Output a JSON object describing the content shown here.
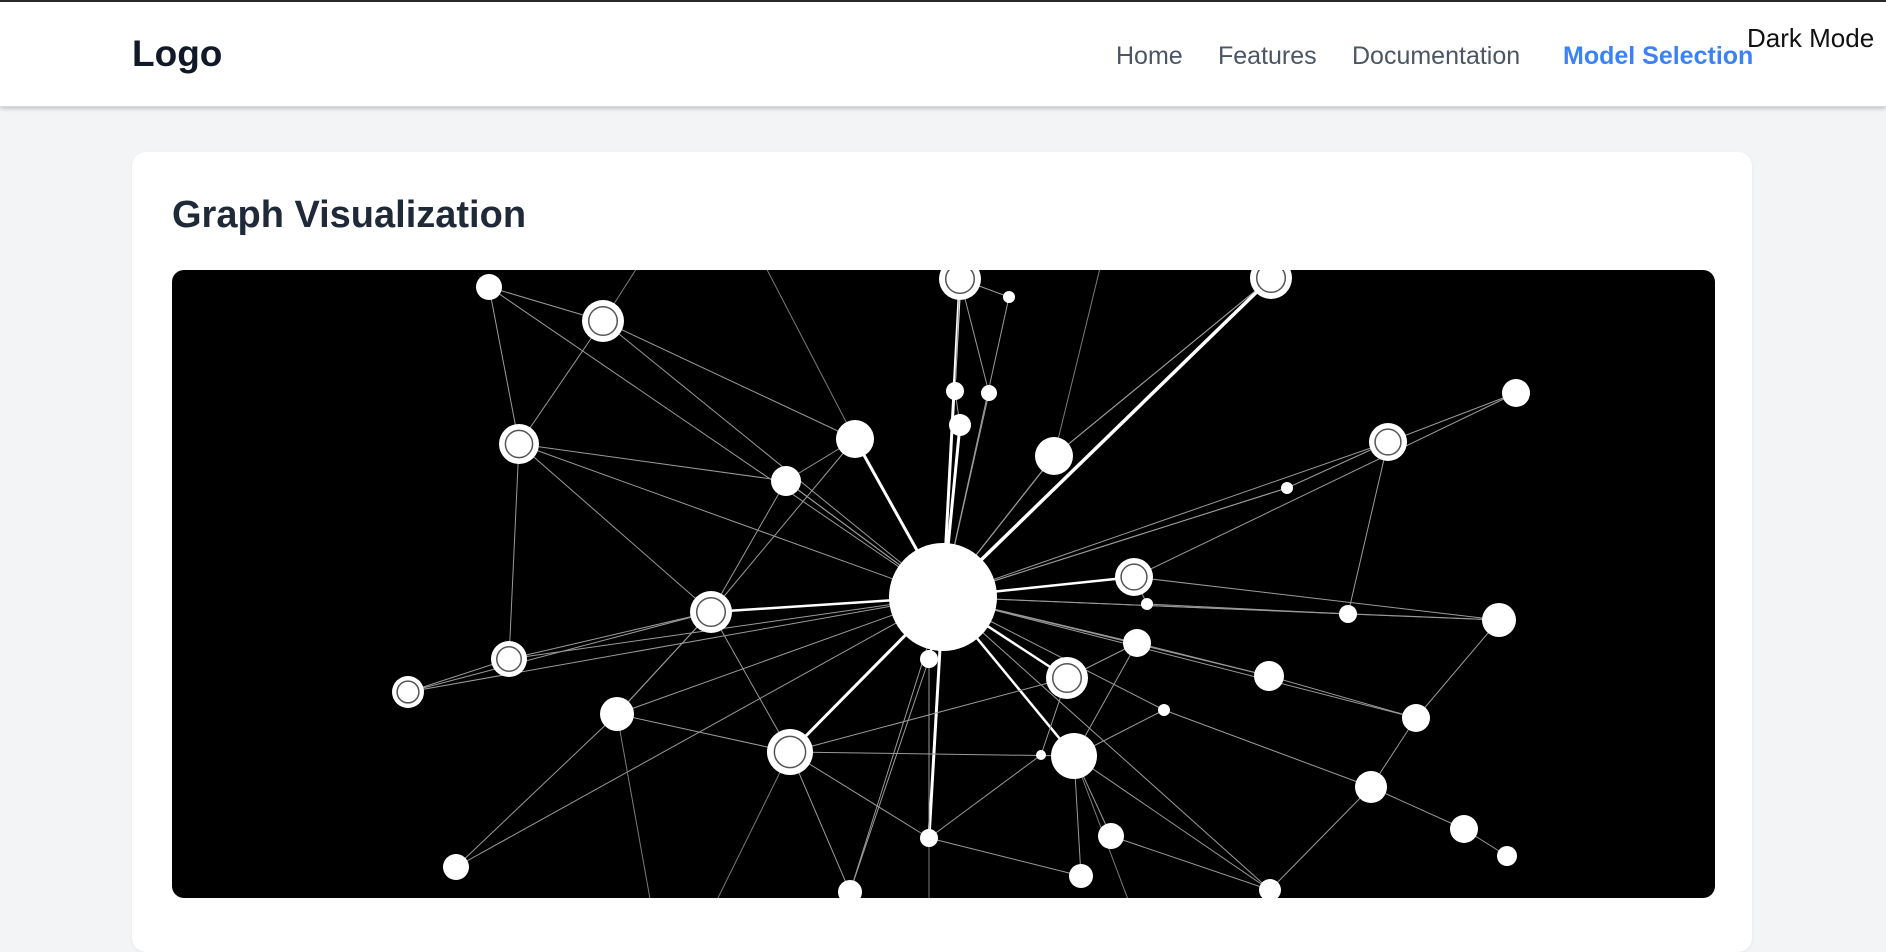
{
  "header": {
    "logo": "Logo",
    "nav": [
      {
        "label": "Home",
        "active": false
      },
      {
        "label": "Features",
        "active": false
      },
      {
        "label": "Documentation",
        "active": false
      },
      {
        "label": "Model Selection",
        "active": true
      }
    ],
    "dark_mode_label": "Dark Mode"
  },
  "main": {
    "card_title": "Graph Visualization"
  },
  "colors": {
    "accent": "#3b82f6",
    "page_background": "#f3f4f6",
    "graph_background": "#000000",
    "graph_node": "#ffffff"
  }
}
